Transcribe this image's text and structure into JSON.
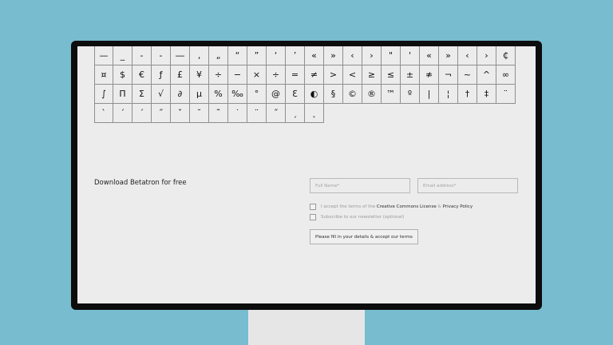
{
  "glyph_rows": [
    [
      "—",
      "_",
      "‐",
      "‑",
      "―",
      "‚",
      "„",
      "“",
      "”",
      "‘",
      "’",
      "«",
      "»",
      "‹",
      "›",
      "\"",
      "'",
      "«",
      "»",
      "‹",
      "›",
      "₵"
    ],
    [
      "¤",
      "$",
      "€",
      "ƒ",
      "£",
      "¥",
      "÷",
      "−",
      "×",
      "÷",
      "=",
      "≠",
      ">",
      "<",
      "≥",
      "≤",
      "±",
      "≉",
      "¬",
      "~",
      "^",
      "∞"
    ],
    [
      "∫",
      "Π",
      "Σ",
      "√",
      "∂",
      "µ",
      "%",
      "‰",
      "°",
      "@",
      "Ɛ",
      "◐",
      "§",
      "©",
      "®",
      "™",
      "º",
      "|",
      "¦",
      "†",
      "‡",
      "¨"
    ],
    [
      "`",
      "´",
      "ˊ",
      "˝",
      "ˇ",
      "˘",
      "˜",
      "˙",
      "¨",
      "˝",
      "ˏ",
      "˛"
    ]
  ],
  "download": {
    "title": "Download Betatron for free"
  },
  "form": {
    "full_name_placeholder": "Full Name*",
    "email_placeholder": "Email address*",
    "terms_prefix": "I accept the terms of the",
    "terms_license": "Creative Commons License",
    "terms_amp": "&",
    "terms_privacy": "Privacy Policy",
    "newsletter": "Subscribe to our newsletter (optional)",
    "submit_label": "Please fill in your details & accept our terms"
  },
  "colors": {
    "background": "#78bccf",
    "screen": "#ececec",
    "bezel": "#0d0d0d"
  }
}
